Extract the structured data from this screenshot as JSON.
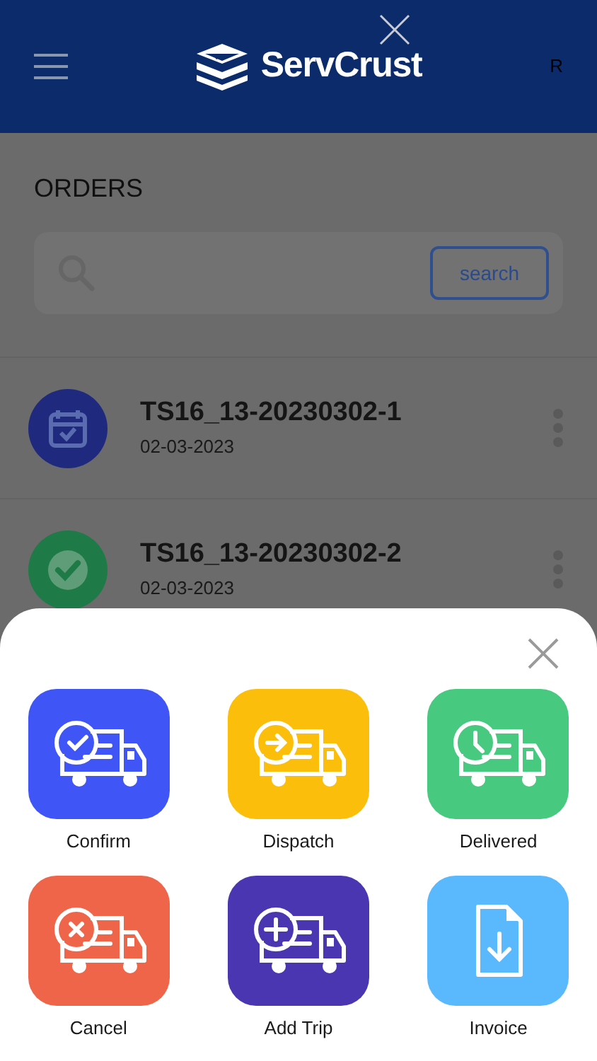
{
  "header": {
    "brand": "ServCrust",
    "user_initial": "R"
  },
  "page": {
    "title": "ORDERS",
    "search_button": "search"
  },
  "orders": [
    {
      "kind": "calendar",
      "number": "TS16_13-20230302-1",
      "date": "02-03-2023",
      "color": "#1f2a7e"
    },
    {
      "kind": "check",
      "number": "TS16_13-20230302-2",
      "date": "02-03-2023",
      "color": "#1e7a46"
    }
  ],
  "action_sheet": {
    "actions": [
      {
        "kind": "check",
        "label": "Confirm",
        "color": "#3f55f6"
      },
      {
        "kind": "arrow",
        "label": "Dispatch",
        "color": "#fbbf0b"
      },
      {
        "kind": "clock",
        "label": "Delivered",
        "color": "#47c97f"
      },
      {
        "kind": "cross",
        "label": "Cancel",
        "color": "#ef6549"
      },
      {
        "kind": "plus",
        "label": "Add Trip",
        "color": "#4a36b0"
      },
      {
        "kind": "invoice",
        "label": "Invoice",
        "color": "#5ab8fd"
      }
    ]
  }
}
